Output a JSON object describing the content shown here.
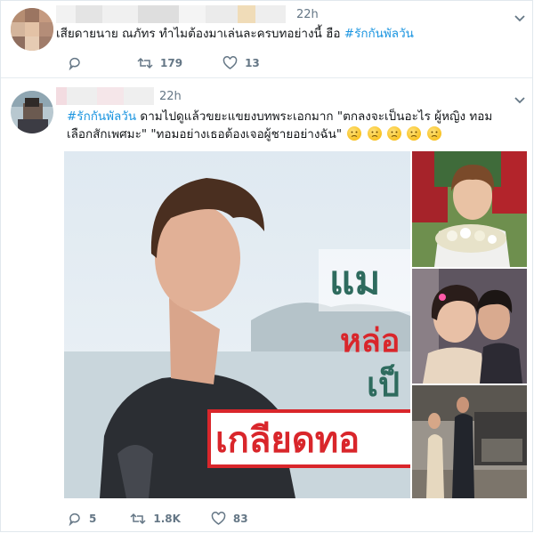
{
  "tweet1": {
    "time": "22h",
    "text": "เสียดายนาย ณภัทร ทำไมต้องมาเล่นละครบทอย่างนี้ ฮือ",
    "hashtag": "#รักกันพัลวัน",
    "actions": {
      "replies": "",
      "retweets": "179",
      "likes": "13"
    }
  },
  "tweet2": {
    "time": "22h",
    "hashtag": "#รักกันพัลวัน",
    "line1": "ดามไปดูแล้วขยะแขยงบทพระเอกมาก \"ตกลงจะเป็นอะไร ผู้หญิง ทอม",
    "line2": "เลือกสักเพศมะ\" \"ทอมอย่างเธอต้องเจอผู้ชายอย่างฉัน\"",
    "emoji": [
      "slightly-frowning-face",
      "slightly-frowning-face",
      "slightly-frowning-face",
      "slightly-frowning-face",
      "slightly-frowning-face"
    ],
    "media_text": {
      "line1": "แม",
      "line2": "หล่อ",
      "line3": "เป็",
      "banner": "เกลียดทอ"
    },
    "actions": {
      "replies": "5",
      "retweets": "1.8K",
      "likes": "83"
    }
  },
  "colors": {
    "link": "#1b95e0",
    "icon": "#657786",
    "banner_red": "#d9262b",
    "title_green": "#2e6b5e"
  }
}
